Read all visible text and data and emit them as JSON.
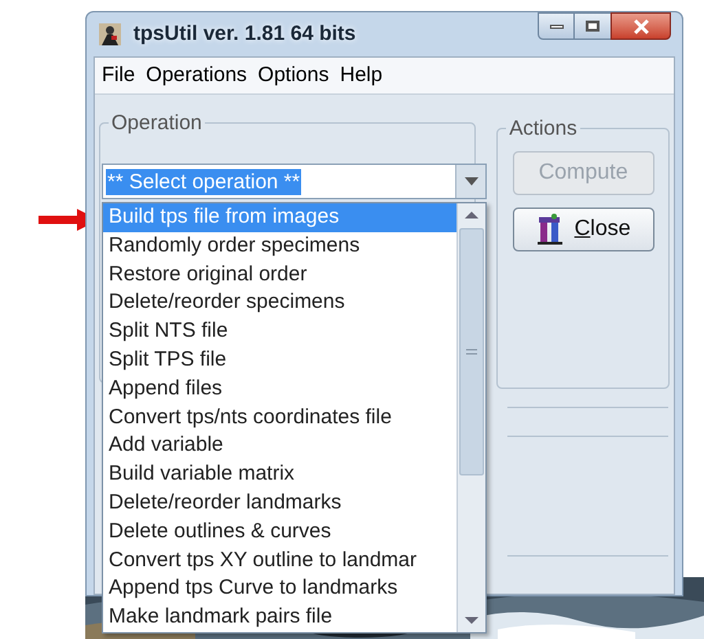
{
  "window": {
    "title": "tpsUtil ver. 1.81 64 bits"
  },
  "menu": [
    "File",
    "Operations",
    "Options",
    "Help"
  ],
  "operation": {
    "label": "Operation",
    "combo_value": "** Select operation **",
    "items": [
      {
        "label": "Build tps file from images",
        "selected": true
      },
      {
        "label": "Randomly order specimens",
        "selected": false
      },
      {
        "label": "Restore original order",
        "selected": false
      },
      {
        "label": "Delete/reorder specimens",
        "selected": false
      },
      {
        "label": "Split NTS file",
        "selected": false
      },
      {
        "label": "Split TPS file",
        "selected": false
      },
      {
        "label": "Append files",
        "selected": false
      },
      {
        "label": "Convert tps/nts coordinates file",
        "selected": false
      },
      {
        "label": "Add variable",
        "selected": false
      },
      {
        "label": "Build variable matrix",
        "selected": false
      },
      {
        "label": "Delete/reorder landmarks",
        "selected": false
      },
      {
        "label": "Delete outlines & curves",
        "selected": false
      },
      {
        "label": "Convert tps XY outline to landmar",
        "selected": false
      },
      {
        "label": "Append tps Curve to landmarks",
        "selected": false
      },
      {
        "label": "Make landmark pairs file",
        "selected": false
      }
    ]
  },
  "actions": {
    "label": "Actions",
    "buttons": [
      {
        "label": "Compute",
        "disabled": true,
        "kind": "plain"
      },
      {
        "label": "Close",
        "disabled": false,
        "kind": "icon",
        "first_letter_underlined": true
      }
    ]
  }
}
